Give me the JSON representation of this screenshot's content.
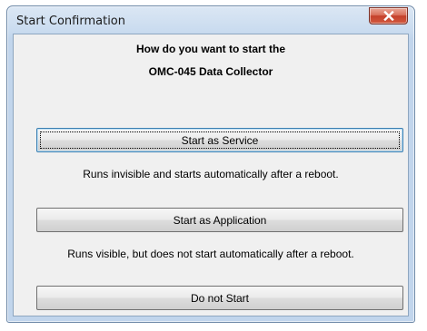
{
  "window": {
    "title": "Start Confirmation"
  },
  "dialog": {
    "heading_line1": "How do you want to start the",
    "heading_line2": "OMC-045 Data Collector",
    "options": [
      {
        "button_label": "Start as Service",
        "description": "Runs invisible and starts automatically after a reboot."
      },
      {
        "button_label": "Start as Application",
        "description": "Runs visible, but does not start automatically after a reboot."
      },
      {
        "button_label": "Do not Start"
      }
    ]
  },
  "icons": {
    "close": "close-icon"
  },
  "colors": {
    "close_button": "#c4402b",
    "client_background": "#f0f0f0",
    "frame": "#c1d5ec"
  }
}
